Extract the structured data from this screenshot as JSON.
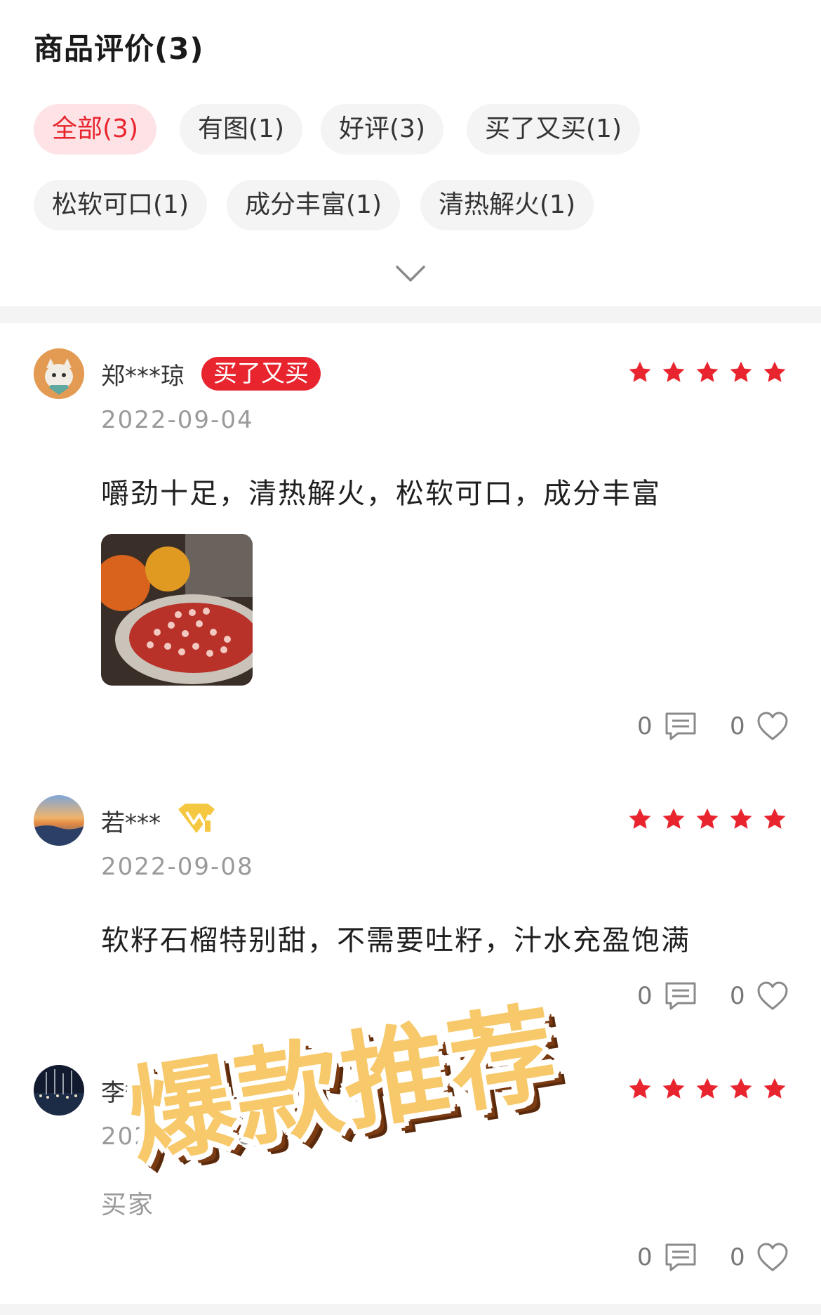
{
  "header": {
    "title": "商品评价(3)"
  },
  "filters": [
    {
      "label": "全部(3)",
      "active": true
    },
    {
      "label": "有图(1)",
      "active": false
    },
    {
      "label": "好评(3)",
      "active": false
    },
    {
      "label": "买了又买(1)",
      "active": false
    },
    {
      "label": "松软可口(1)",
      "active": false
    },
    {
      "label": "成分丰富(1)",
      "active": false
    },
    {
      "label": "清热解火(1)",
      "active": false
    }
  ],
  "reviews": [
    {
      "user": "郑***琼",
      "badge": "买了又买",
      "rating": 5,
      "date": "2022-09-04",
      "content": "嚼劲十足，清热解火，松软可口，成分丰富",
      "comments": "0",
      "likes": "0"
    },
    {
      "user": "若***",
      "badge_icon": "vip-diamond-icon",
      "rating": 5,
      "date": "2022-09-08",
      "content": "软籽石榴特别甜，不需要吐籽，汁水充盈饱满",
      "comments": "0",
      "likes": "0"
    },
    {
      "user": "李***凯",
      "rating": 5,
      "date": "2022-09-16",
      "content": "买家",
      "comments": "0",
      "likes": "0"
    }
  ],
  "overlay": {
    "text": "爆款推荐"
  },
  "colors": {
    "accent": "#e8252f",
    "chip_bg": "#f4f4f4",
    "active_chip_bg": "#fde3e6"
  }
}
